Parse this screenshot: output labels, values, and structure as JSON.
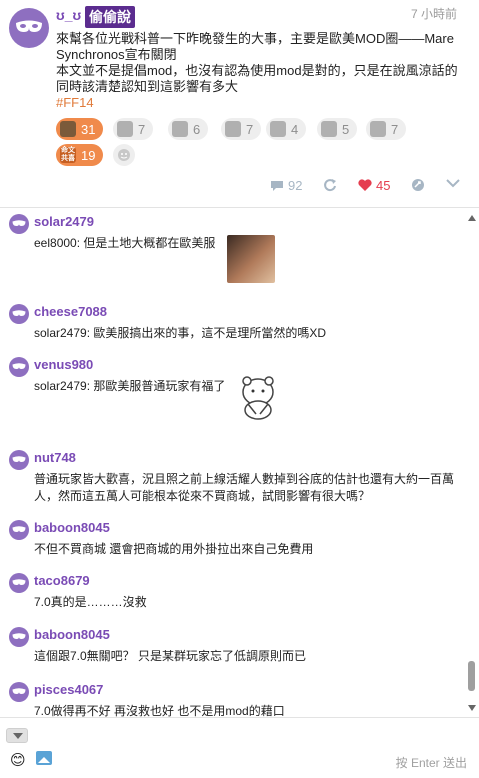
{
  "post": {
    "author": "ʊ_ʊ",
    "tag": "偷偷說",
    "time": "7 小時前",
    "lines": [
      "來幫各位光戰科普一下昨晚發生的大事，主要是歐美MOD圈——Mare",
      "Synchronos宣布關閉",
      "本文並不是提倡mod，也沒有認為使用mod是對的，只是在說風涼話的",
      "同時該清楚認知到這影響有多大"
    ],
    "hashtag": "#FF14",
    "reactions": [
      {
        "count": "31",
        "active": true
      },
      {
        "count": "7",
        "active": false
      },
      {
        "count": "6",
        "active": false
      },
      {
        "count": "7",
        "active": false
      },
      {
        "count": "4",
        "active": false
      },
      {
        "count": "5",
        "active": false
      },
      {
        "count": "7",
        "active": false
      },
      {
        "count": "19",
        "active": true,
        "word": "命文\n共喜"
      }
    ],
    "stats": {
      "comments": "92",
      "likes": "45"
    }
  },
  "comments": [
    {
      "name": "solar2479",
      "text": "eel8000: 但是土地大概都在歐美服",
      "sticker": "image"
    },
    {
      "name": "cheese7088",
      "text": "solar2479: 歐美服搞出來的事，這不是理所當然的嗎XD"
    },
    {
      "name": "venus980",
      "text": "solar2479: 那歐美服普通玩家有福了",
      "sticker": "doodle"
    },
    {
      "name": "nut748",
      "text": "普通玩家皆大歡喜，況且照之前上線活耀人數掉到谷底的估計也還有大約一百萬人，然而這五萬人可能根本從來不買商城，試問影響有很大嗎？"
    },
    {
      "name": "baboon8045",
      "text": "不但不買商城 還會把商城的用外掛拉出來自己免費用"
    },
    {
      "name": "taco8679",
      "text": "7.0真的是………沒救"
    },
    {
      "name": "baboon8045",
      "text": "這個跟7.0無關吧？ 只是某群玩家忘了低調原則而已"
    },
    {
      "name": "pisces4067",
      "text": "7.0做得再不好 再沒救也好 也不是用mod的藉口"
    }
  ],
  "composer": {
    "placeholder": "",
    "send_hint": "按 Enter 送出"
  },
  "colors": {
    "accent": "#7a4bb5",
    "tag_bg": "#5b2c8f",
    "reaction_active": "#f08a4b",
    "heart": "#e53d4f",
    "hashtag": "#e07a3a"
  }
}
